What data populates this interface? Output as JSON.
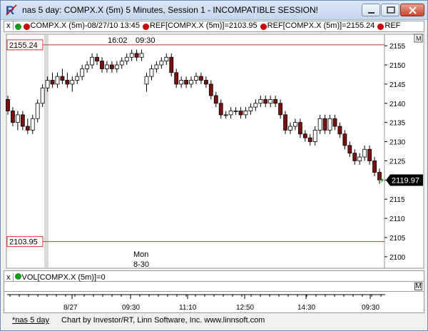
{
  "window": {
    "title": "nas 5 day: COMPX.X (5m) 5 Minutes, Session 1 - INCOMPATIBLE SESSION!",
    "app_icon": "R"
  },
  "study_bar": {
    "close_symbol": "x",
    "symbol_label": "COMPX.X (5m)-08/27/10 13:45",
    "ref1_label": "REF[COMPX.X (5m)]=2103.95",
    "ref2_label": "REF[COMPX.X (5m)]=2155.24",
    "more_label": "REF",
    "dot_colors": [
      "#1a9a1a",
      "#cc0000",
      "#cc0000",
      "#cc0000"
    ]
  },
  "chart": {
    "price_axis": [
      "2155",
      "2150",
      "2145",
      "2140",
      "2135",
      "2130",
      "2125",
      "2120",
      "2115",
      "2110",
      "2105",
      "2100"
    ],
    "ref_high": "2155.24",
    "ref_low": "2103.95",
    "last_price": "2119.97",
    "top_label_time1": "16:02",
    "top_label_time2": "09:30",
    "session_label_day": "Mon",
    "session_label_date": "8-30",
    "corner_button": "M"
  },
  "chart_data": {
    "type": "candlestick",
    "ylim": [
      2097,
      2158
    ],
    "ref_lines": [
      2155.24,
      2103.95
    ],
    "last": 2119.97,
    "x_ticks": [
      "8/27",
      "09:30",
      "11:10",
      "12:50",
      "14:30",
      "09:30"
    ],
    "candles": [
      [
        2141,
        2142,
        2137,
        2138
      ],
      [
        2138,
        2139,
        2134,
        2135
      ],
      [
        2135,
        2138,
        2133,
        2137
      ],
      [
        2137,
        2138,
        2133,
        2134
      ],
      [
        2134,
        2136,
        2132,
        2133
      ],
      [
        2133,
        2137,
        2132,
        2136
      ],
      [
        2136,
        2141,
        2135,
        2140
      ],
      [
        2140,
        2145,
        2139,
        2144
      ],
      [
        2144,
        2147,
        2143,
        2146
      ],
      [
        2146,
        2148,
        2144,
        2145
      ],
      [
        2145,
        2148,
        2144,
        2147
      ],
      [
        2147,
        2149,
        2145,
        2146
      ],
      [
        2146,
        2148,
        2144,
        2145
      ],
      [
        2145,
        2147,
        2143,
        2146
      ],
      [
        2146,
        2148,
        2145,
        2147
      ],
      [
        2147,
        2150,
        2146,
        2149
      ],
      [
        2149,
        2151,
        2148,
        2150
      ],
      [
        2150,
        2153,
        2149,
        2152
      ],
      [
        2152,
        2153,
        2150,
        2151
      ],
      [
        2151,
        2152,
        2148,
        2149
      ],
      [
        2149,
        2151,
        2148,
        2150
      ],
      [
        2150,
        2151,
        2148,
        2149
      ],
      [
        2149,
        2151,
        2148,
        2150
      ],
      [
        2150,
        2152,
        2149,
        2151
      ],
      [
        2151,
        2153,
        2150,
        2152
      ],
      [
        2152,
        2154,
        2151,
        2153
      ],
      [
        2153,
        2154,
        2151,
        2152
      ],
      [
        2152,
        2154,
        2151,
        2153
      ],
      [
        2145,
        2148,
        2143,
        2147
      ],
      [
        2147,
        2150,
        2146,
        2149
      ],
      [
        2149,
        2151,
        2148,
        2150
      ],
      [
        2150,
        2152,
        2149,
        2151
      ],
      [
        2151,
        2153,
        2150,
        2152
      ],
      [
        2152,
        2153,
        2147,
        2148
      ],
      [
        2148,
        2149,
        2144,
        2145
      ],
      [
        2145,
        2147,
        2144,
        2146
      ],
      [
        2146,
        2147,
        2144,
        2145
      ],
      [
        2145,
        2147,
        2144,
        2146
      ],
      [
        2146,
        2148,
        2145,
        2147
      ],
      [
        2147,
        2148,
        2145,
        2146
      ],
      [
        2146,
        2147,
        2144,
        2145
      ],
      [
        2145,
        2146,
        2141,
        2142
      ],
      [
        2142,
        2143,
        2139,
        2140
      ],
      [
        2140,
        2141,
        2136,
        2137
      ],
      [
        2137,
        2138,
        2136,
        2137
      ],
      [
        2137,
        2139,
        2136,
        2138
      ],
      [
        2138,
        2139,
        2137,
        2138
      ],
      [
        2138,
        2139,
        2136,
        2137
      ],
      [
        2137,
        2139,
        2136,
        2138
      ],
      [
        2138,
        2140,
        2137,
        2139
      ],
      [
        2139,
        2141,
        2138,
        2140
      ],
      [
        2140,
        2142,
        2139,
        2141
      ],
      [
        2141,
        2142,
        2139,
        2140
      ],
      [
        2140,
        2142,
        2139,
        2141
      ],
      [
        2141,
        2142,
        2139,
        2140
      ],
      [
        2140,
        2141,
        2136,
        2137
      ],
      [
        2137,
        2138,
        2132,
        2133
      ],
      [
        2133,
        2135,
        2132,
        2134
      ],
      [
        2134,
        2136,
        2133,
        2135
      ],
      [
        2135,
        2136,
        2131,
        2132
      ],
      [
        2132,
        2133,
        2130,
        2131
      ],
      [
        2131,
        2132,
        2129,
        2130
      ],
      [
        2130,
        2134,
        2129,
        2133
      ],
      [
        2133,
        2137,
        2132,
        2136
      ],
      [
        2136,
        2137,
        2132,
        2133
      ],
      [
        2133,
        2137,
        2132,
        2136
      ],
      [
        2136,
        2137,
        2133,
        2134
      ],
      [
        2134,
        2135,
        2131,
        2132
      ],
      [
        2132,
        2133,
        2128,
        2129
      ],
      [
        2129,
        2130,
        2126,
        2127
      ],
      [
        2127,
        2128,
        2124,
        2125
      ],
      [
        2125,
        2127,
        2124,
        2126
      ],
      [
        2126,
        2129,
        2125,
        2128
      ],
      [
        2128,
        2129,
        2124,
        2125
      ],
      [
        2125,
        2126,
        2121,
        2122
      ],
      [
        2122,
        2123,
        2119,
        2120
      ]
    ]
  },
  "volume_bar": {
    "close_symbol": "x",
    "label": "VOL[COMPX.X (5m)]=0",
    "dot_color": "#1a9a1a",
    "corner_button": "M"
  },
  "time_axis": {
    "labels": [
      "8/27",
      "09:30",
      "11:10",
      "12:50",
      "14:30",
      "09:30"
    ]
  },
  "footer": {
    "tab_label": "*nas 5 day",
    "credit": "Chart by Investor/RT, Linn Software, Inc. www.linnsoft.com"
  }
}
